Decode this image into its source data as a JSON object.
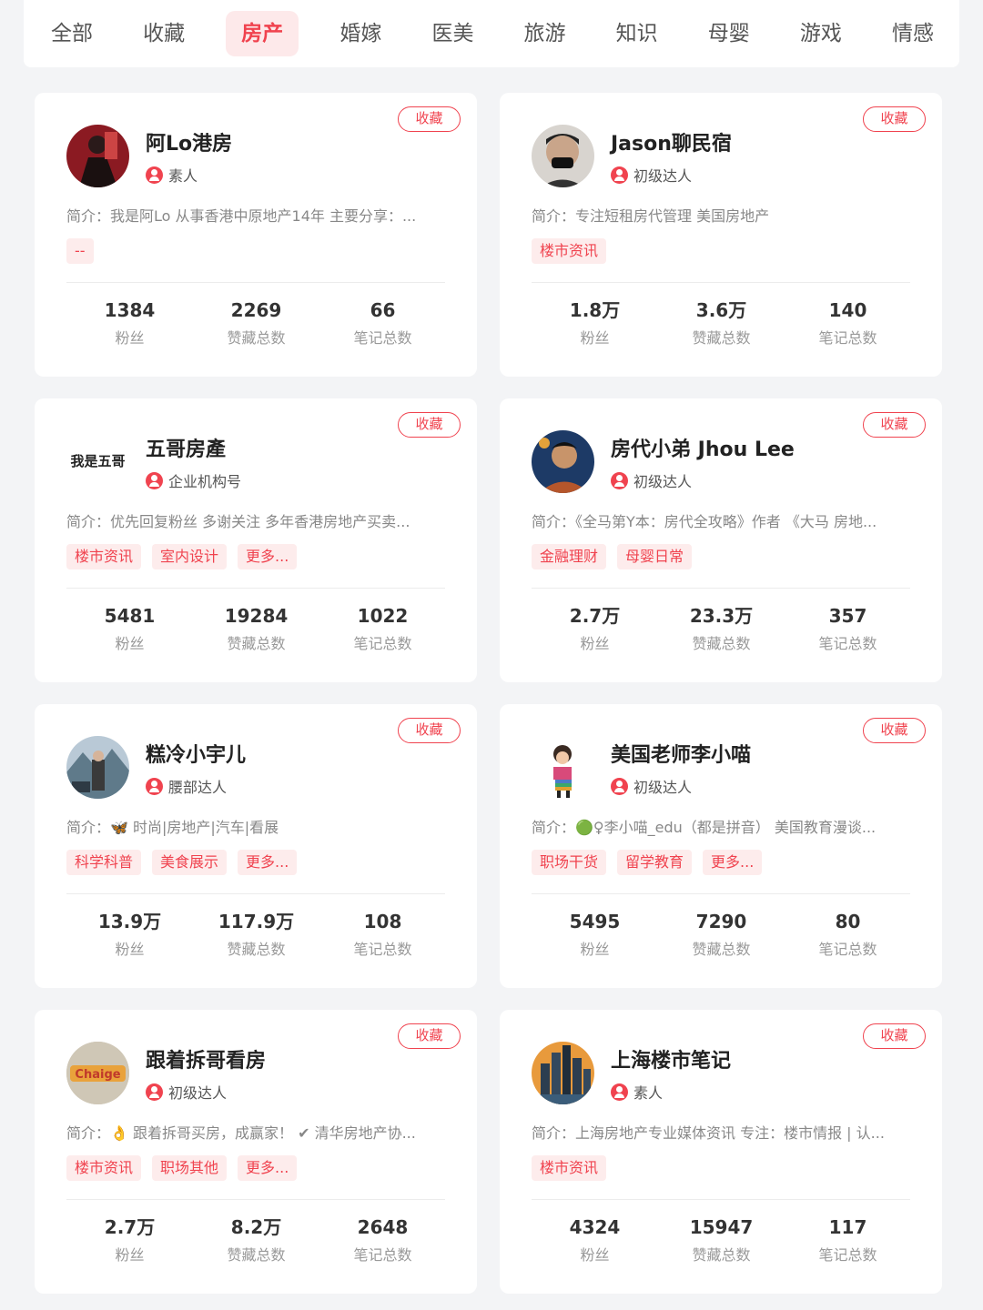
{
  "tabs": [
    "全部",
    "收藏",
    "房产",
    "婚嫁",
    "医美",
    "旅游",
    "知识",
    "母婴",
    "游戏",
    "情感"
  ],
  "active_tab": "房产",
  "labels": {
    "favorite": "收藏",
    "fans": "粉丝",
    "likes": "赞藏总数",
    "notes": "笔记总数"
  },
  "cards": [
    {
      "name": "阿Lo港房",
      "level": "素人",
      "bio": "简介：我是阿Lo 从事香港中原地产14年 主要分享：...",
      "tags": [
        "--"
      ],
      "fans": "1384",
      "likes": "2269",
      "notes": "66"
    },
    {
      "name": "Jason聊民宿",
      "level": "初级达人",
      "bio": "简介：专注短租房代管理 美国房地产",
      "tags": [
        "楼市资讯"
      ],
      "fans": "1.8万",
      "likes": "3.6万",
      "notes": "140"
    },
    {
      "name": "五哥房產",
      "level": "企业机构号",
      "avatar_text": "我是五哥",
      "bio": "简介：优先回复粉丝 多谢关注 多年香港房地产买卖...",
      "tags": [
        "楼市资讯",
        "室内设计",
        "更多..."
      ],
      "fans": "5481",
      "likes": "19284",
      "notes": "1022"
    },
    {
      "name": "房代小弟 Jhou Lee",
      "level": "初级达人",
      "bio": "简介：《全马第Y本：房代全攻略》作者 《大马 房地...",
      "tags": [
        "金融理财",
        "母婴日常"
      ],
      "fans": "2.7万",
      "likes": "23.3万",
      "notes": "357"
    },
    {
      "name": "糕冷小宇儿",
      "level": "腰部达人",
      "bio": "简介：🦋 时尚|房地产|汽车|看展",
      "tags": [
        "科学科普",
        "美食展示",
        "更多..."
      ],
      "fans": "13.9万",
      "likes": "117.9万",
      "notes": "108"
    },
    {
      "name": "美国老师李小喵",
      "level": "初级达人",
      "bio": "简介：🟢♀李小喵_edu（都是拼音） 美国教育漫谈...",
      "tags": [
        "职场干货",
        "留学教育",
        "更多..."
      ],
      "fans": "5495",
      "likes": "7290",
      "notes": "80"
    },
    {
      "name": "跟着拆哥看房",
      "level": "初级达人",
      "avatar_text": "Chaige",
      "bio": "简介：👌 跟着拆哥买房，成赢家！ ✔ 清华房地产协...",
      "tags": [
        "楼市资讯",
        "职场其他",
        "更多..."
      ],
      "fans": "2.7万",
      "likes": "8.2万",
      "notes": "2648"
    },
    {
      "name": "上海楼市笔记",
      "level": "素人",
      "bio": "简介：上海房地产专业媒体资讯 专注：楼市情报 | 认...",
      "tags": [
        "楼市资讯"
      ],
      "fans": "4324",
      "likes": "15947",
      "notes": "117"
    }
  ]
}
